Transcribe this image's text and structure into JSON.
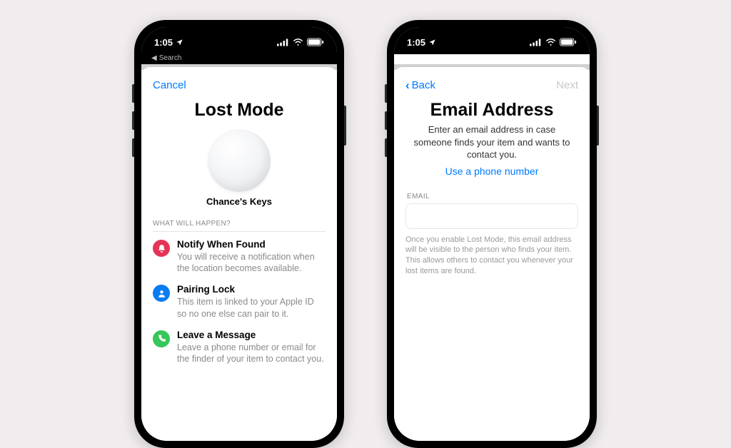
{
  "statusbar": {
    "time": "1:05"
  },
  "breadcrumb": {
    "label": "Search"
  },
  "left": {
    "cancel": "Cancel",
    "title": "Lost Mode",
    "item_name": "Chance's Keys",
    "section_header": "WHAT WILL HAPPEN?",
    "rows": {
      "notify": {
        "title": "Notify When Found",
        "body": "You will receive a notification when the location becomes available."
      },
      "lock": {
        "title": "Pairing Lock",
        "body": "This item is linked to your Apple ID so no one else can pair to it."
      },
      "msg": {
        "title": "Leave a Message",
        "body": "Leave a phone number or email for the finder of your item to contact you."
      }
    }
  },
  "right": {
    "back": "Back",
    "next": "Next",
    "title": "Email Address",
    "description": "Enter an email address in case someone finds your item and wants to contact you.",
    "use_phone": "Use a phone number",
    "field_label": "EMAIL",
    "email_value": "",
    "helper": "Once you enable Lost Mode, this email address will be visible to the person who finds your item. This allows others to contact you whenever your lost items are found."
  },
  "colors": {
    "notify": "#e63457",
    "lock": "#0a7cf2",
    "msg": "#35c759",
    "link": "#007aff"
  }
}
